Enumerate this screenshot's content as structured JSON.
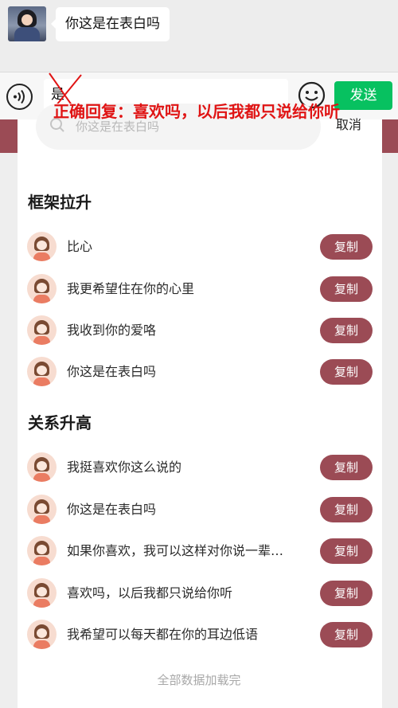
{
  "chat": {
    "message": "你这是在表白吗"
  },
  "input_bar": {
    "text": "是",
    "send_label": "发送",
    "voice_glyph": "◁))"
  },
  "annotation": {
    "text": "正确回复：喜欢吗，以后我都只说给你听",
    "color": "#e01414"
  },
  "search": {
    "placeholder": "你这是在表白吗",
    "cancel_label": "取消"
  },
  "sections": [
    {
      "title": "框架拉升",
      "items": [
        {
          "text": "比心",
          "button": "复制"
        },
        {
          "text": "我更希望住在你的心里",
          "button": "复制"
        },
        {
          "text": "我收到你的爱咯",
          "button": "复制"
        },
        {
          "text": "你这是在表白吗",
          "button": "复制"
        }
      ]
    },
    {
      "title": "关系升高",
      "items": [
        {
          "text": "我挺喜欢你这么说的",
          "button": "复制"
        },
        {
          "text": "你这是在表白吗",
          "button": "复制"
        },
        {
          "text": "如果你喜欢，我可以这样对你说一辈…",
          "button": "复制"
        },
        {
          "text": "喜欢吗，以后我都只说给你听",
          "button": "复制"
        },
        {
          "text": "我希望可以每天都在你的耳边低语",
          "button": "复制"
        }
      ]
    }
  ],
  "footer": {
    "text": "全部数据加载完"
  },
  "colors": {
    "accent": "#9b4b55",
    "send_green": "#07c160"
  },
  "icons": [
    "voice-icon",
    "emoji-icon",
    "search-icon",
    "user-avatar-icon"
  ]
}
